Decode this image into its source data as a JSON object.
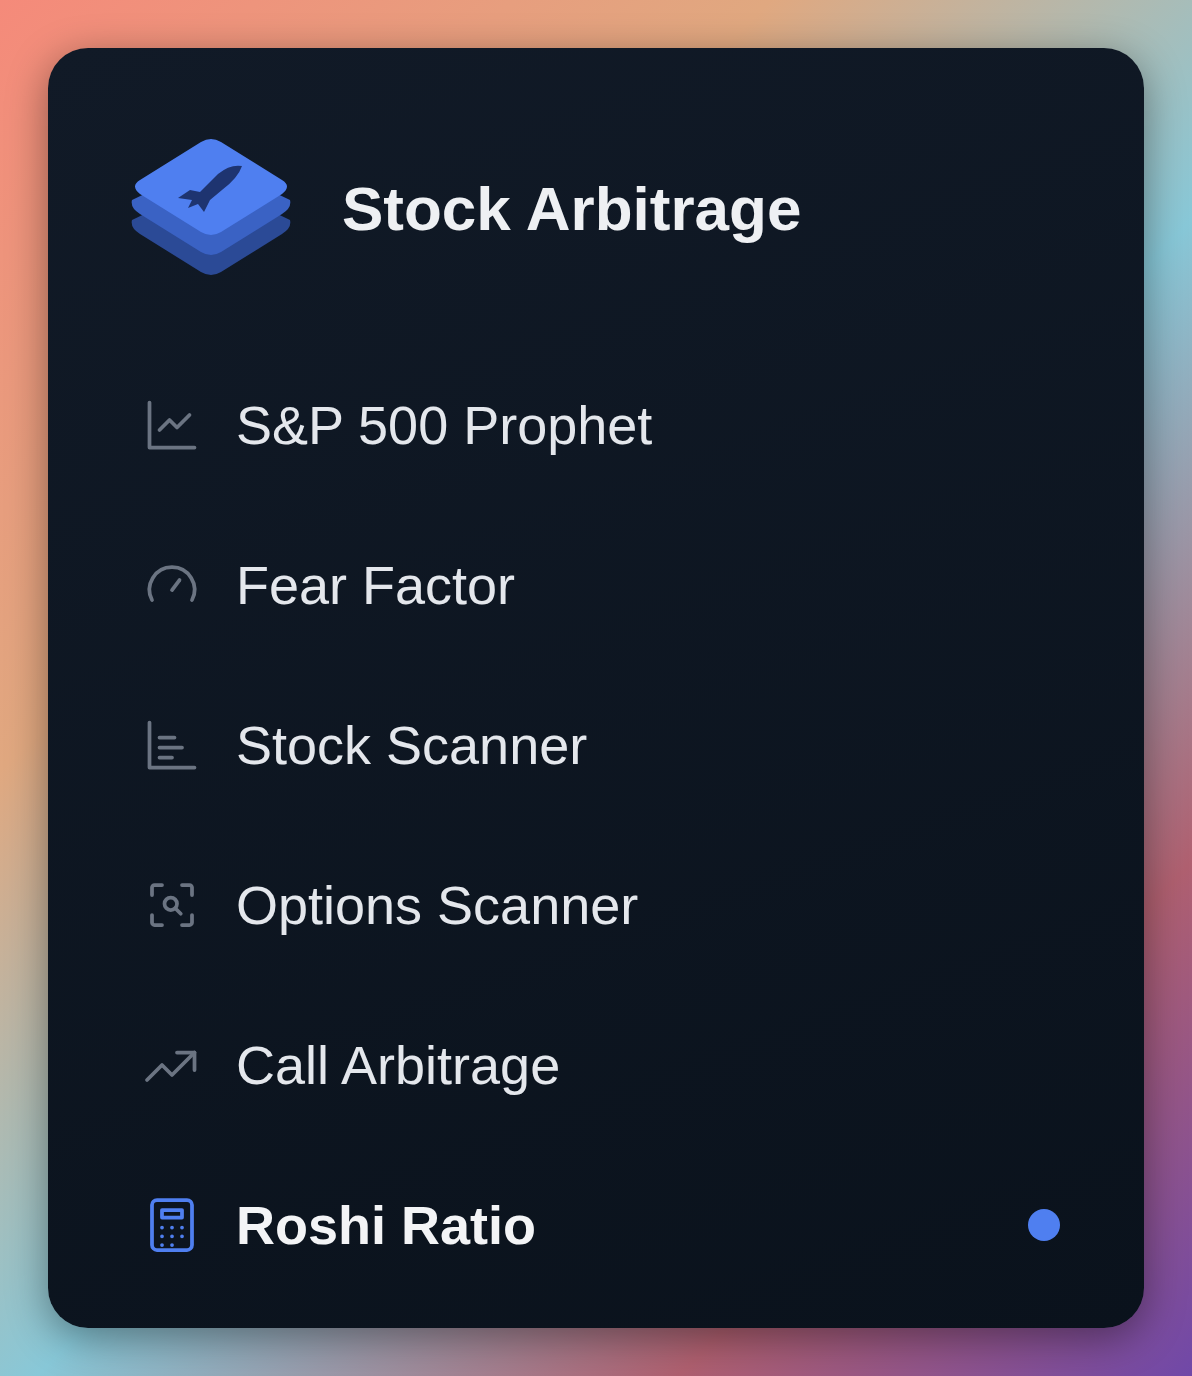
{
  "app": {
    "title": "Stock Arbitrage"
  },
  "nav_items": [
    {
      "label": "S&P 500 Prophet",
      "kind": "line-chart",
      "selected": false
    },
    {
      "label": "Fear Factor",
      "kind": "gauge",
      "selected": false
    },
    {
      "label": "Stock Scanner",
      "kind": "bar-chart",
      "selected": false
    },
    {
      "label": "Options Scanner",
      "kind": "scan",
      "selected": false
    },
    {
      "label": "Call Arbitrage",
      "kind": "trend",
      "selected": false
    },
    {
      "label": "Roshi Ratio",
      "kind": "calculator",
      "selected": true
    }
  ]
}
